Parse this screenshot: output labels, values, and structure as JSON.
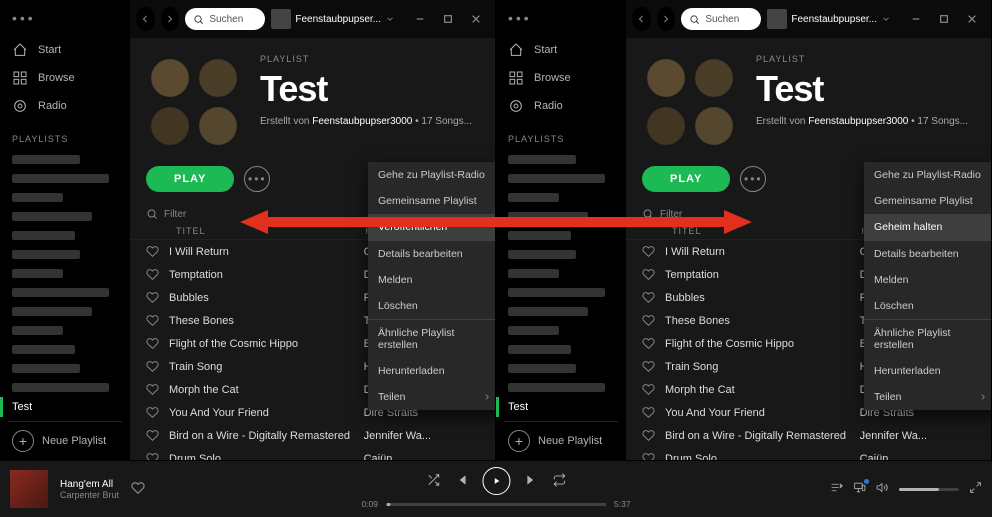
{
  "search_placeholder": "Suchen",
  "user": "Feenstaubpupser...",
  "sidebar": {
    "start": "Start",
    "browse": "Browse",
    "radio": "Radio",
    "playlists_header": "PLAYLISTS",
    "active": "Test",
    "new_playlist": "Neue Playlist"
  },
  "hero": {
    "kind": "PLAYLIST",
    "title": "Test",
    "by_prefix": "Erstellt von",
    "by_user": "Feenstaubpupser3000",
    "count": "17 Songs...",
    "play": "PLAY",
    "download": "Herunterladen"
  },
  "filter": "Filter",
  "cols": {
    "title": "TITEL",
    "artist": "KÜNSTLER*IN"
  },
  "tracks": [
    {
      "t": "I Will Return",
      "a": "OTTO"
    },
    {
      "t": "Temptation",
      "a": "Diana Krall"
    },
    {
      "t": "Bubbles",
      "a": "Ryo Horikawa"
    },
    {
      "t": "These Bones",
      "a": "The Fairfiel..."
    },
    {
      "t": "Flight of the Cosmic Hippo",
      "a": "Béla Fleck a..."
    },
    {
      "t": "Train Song",
      "a": "Holly Cole"
    },
    {
      "t": "Morph the Cat",
      "a": "Donald Fagen"
    },
    {
      "t": "You And Your Friend",
      "a": "Dire Straits"
    },
    {
      "t": "Bird on a Wire - Digitally Remastered",
      "a": "Jennifer Wa..."
    },
    {
      "t": "Drum Solo",
      "a": "Cajün"
    }
  ],
  "menu_left": [
    "Gehe zu Playlist-Radio",
    "Gemeinsame Playlist",
    "Veröffentlichen",
    "Details bearbeiten",
    "Melden",
    "Löschen",
    "Ähnliche Playlist erstellen",
    "Herunterladen",
    "Teilen"
  ],
  "menu_right": [
    "Gehe zu Playlist-Radio",
    "Gemeinsame Playlist",
    "Geheim halten",
    "Details bearbeiten",
    "Melden",
    "Löschen",
    "Ähnliche Playlist erstellen",
    "Herunterladen",
    "Teilen"
  ],
  "np": {
    "title": "Hang'em All",
    "artist": "Carpenter Brut",
    "elapsed": "0:09",
    "total": "5:37"
  }
}
